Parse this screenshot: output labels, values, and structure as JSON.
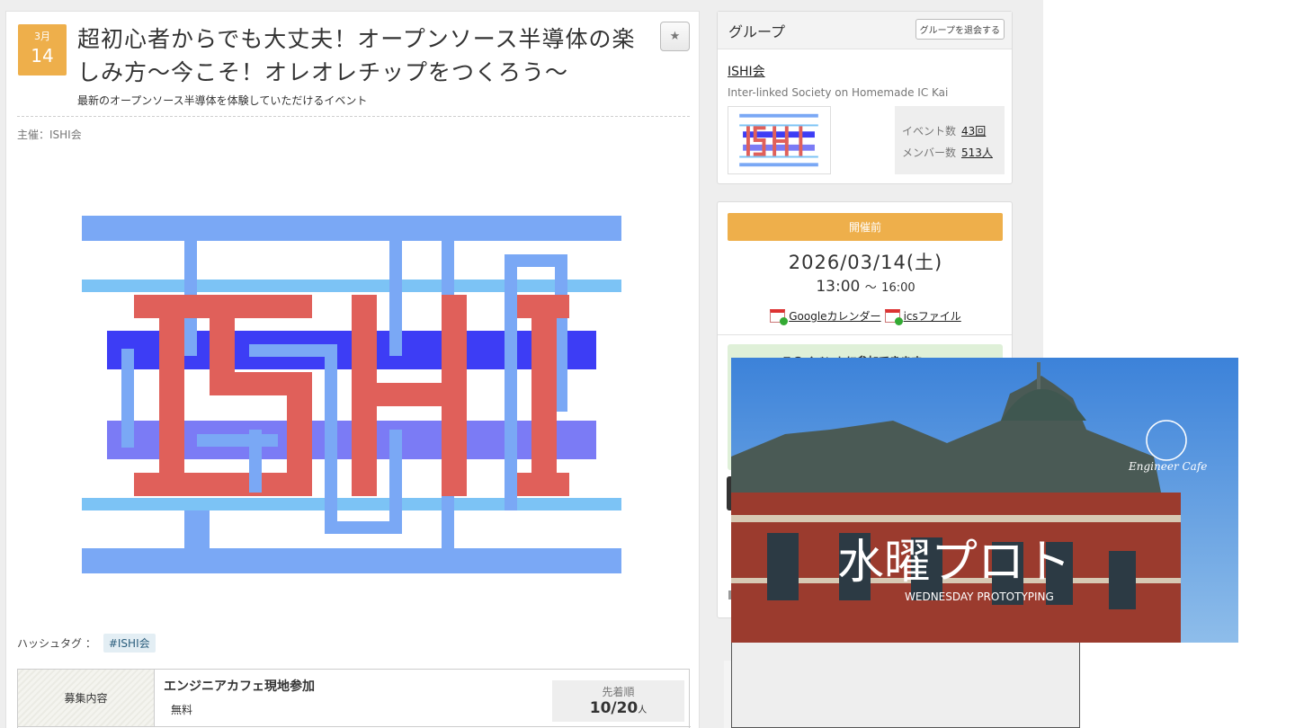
{
  "event": {
    "month": "3月",
    "day": "14",
    "title": "超初心者からでも大丈夫！オープンソース半導体の楽しみ方〜今こそ！オレオレチップをつくろう〜",
    "subtitle": "最新のオープンソース半導体を体験していただけるイベント",
    "organizer": "主催：ISHI会",
    "pin_icon": "★",
    "hashtag_label": "ハッシュタグ ：",
    "hashtag": "#ISHI会",
    "recruit_label": "募集内容",
    "recruit_name": "エンジニアカフェ現地参加",
    "recruit_fee": "無料",
    "capacity_label": "先着順",
    "capacity_value": "10/20",
    "capacity_unit": "人"
  },
  "group": {
    "heading": "グループ",
    "leave_button": "グループを退会する",
    "name": "ISHI会",
    "description": "Inter-linked Society on Homemade IC Kai",
    "event_count_label": "イベント数",
    "event_count": "43回",
    "member_count_label": "メンバー数",
    "member_count": "513人"
  },
  "schedule": {
    "status": "開催前",
    "date": "2026/03/14(土)",
    "start": "13:00",
    "tilde": "〜",
    "end": "16:00",
    "google_calendar": "Googleカレンダー",
    "ics_file": "icsファイル"
  },
  "green_notice": "このイベントに参加できます",
  "overlay": {
    "logo_text": "Engineer Cafe",
    "big_text": "水曜プロト",
    "sub_text": "WEDNESDAY PROTOTYPING"
  },
  "colors": {
    "accent_orange": "#eeaf4b",
    "ishi_red": "#e0605a",
    "ishi_blue": "#3d3df5",
    "ishi_lightblue": "#7aa8f5",
    "sky_blue": "#4f8fe0"
  }
}
